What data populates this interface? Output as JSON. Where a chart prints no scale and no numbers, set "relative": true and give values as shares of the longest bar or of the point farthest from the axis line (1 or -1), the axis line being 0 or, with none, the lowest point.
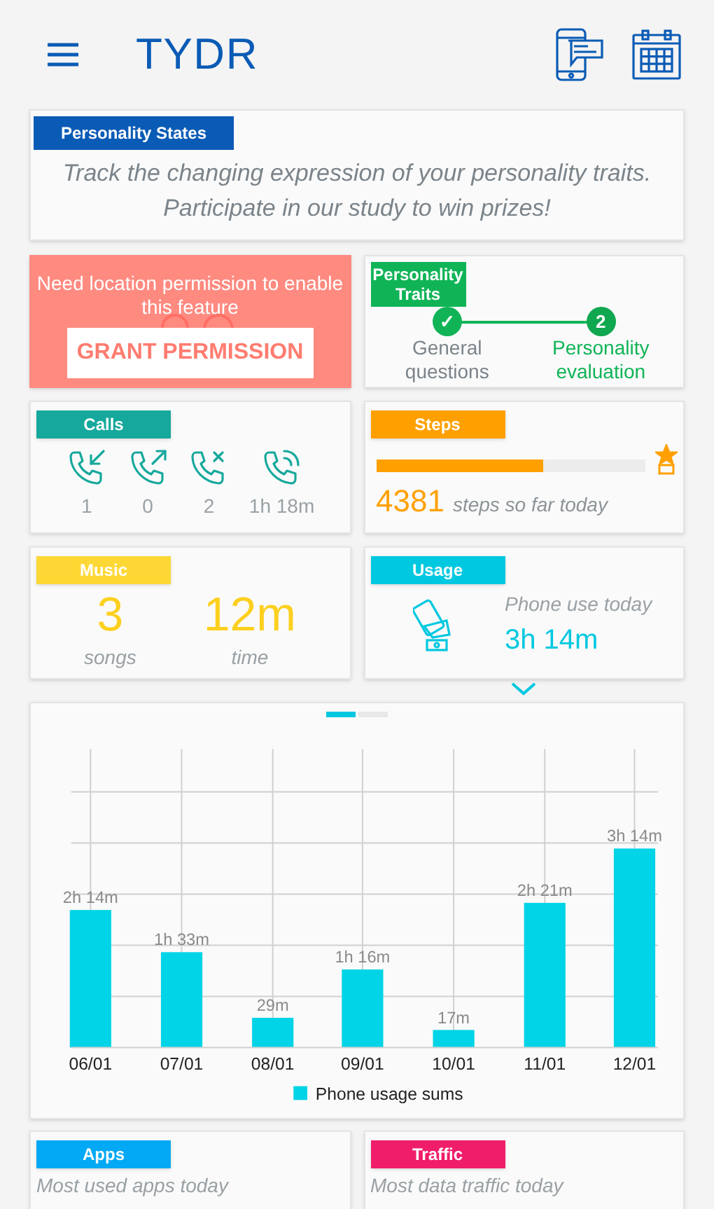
{
  "app_bar": {
    "title": "TYDR"
  },
  "personality_states": {
    "tag": "Personality States",
    "text": "Track the changing expression of your personality traits. Participate in our study to win prizes!"
  },
  "locations": {
    "message": "Need location permission to enable this feature",
    "button": "GRANT PERMISSION"
  },
  "personality_traits": {
    "tag": "Personality Traits",
    "steps": [
      {
        "label": "General questions",
        "done": true,
        "marker": "✓"
      },
      {
        "label": "Personality evaluation",
        "done": false,
        "marker": "2"
      }
    ]
  },
  "calls": {
    "tag": "Calls",
    "items": [
      {
        "kind": "incoming",
        "value": "1"
      },
      {
        "kind": "outgoing",
        "value": "0"
      },
      {
        "kind": "missed",
        "value": "2"
      },
      {
        "kind": "duration",
        "value": "1h 18m"
      }
    ]
  },
  "steps": {
    "tag": "Steps",
    "level": 0.62,
    "count": "4381",
    "caption": "steps so far today"
  },
  "music": {
    "tag": "Music",
    "stats": [
      {
        "value": "3",
        "label": "songs"
      },
      {
        "value": "12m",
        "label": "time"
      }
    ]
  },
  "usage": {
    "tag": "Usage",
    "caption": "Phone use today",
    "value": "3h 14m"
  },
  "pager": [
    {
      "selected": true
    },
    {
      "selected": false
    }
  ],
  "usage_chart": {
    "chart_data": {
      "type": "bar",
      "categories": [
        "06/01",
        "07/01",
        "08/01",
        "09/01",
        "10/01",
        "11/01",
        "12/01"
      ],
      "series": [
        {
          "name": "Phone usage sums",
          "color": "#00d4e6",
          "values": [
            0.691,
            0.479,
            0.149,
            0.392,
            0.088,
            0.727,
            1
          ]
        }
      ],
      "grid": true,
      "relative": true,
      "value_labels": [
        "2h 14m",
        "1h 33m",
        "29m",
        "1h 16m",
        "17m",
        "2h 21m",
        "3h 14m"
      ]
    }
  },
  "apps": {
    "tag": "Apps",
    "caption": "Most used apps today"
  },
  "traffic": {
    "tag": "Traffic",
    "caption": "Most data traffic today"
  }
}
